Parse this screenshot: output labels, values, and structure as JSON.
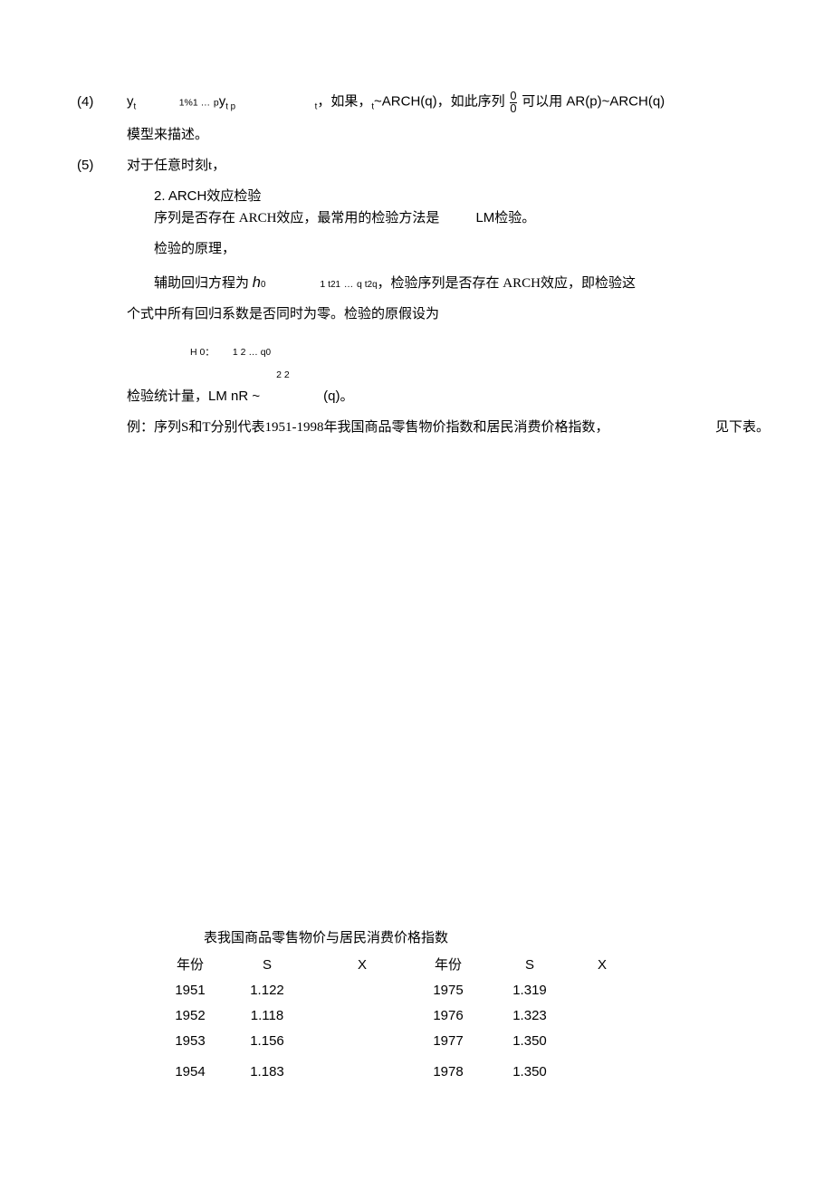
{
  "line4": {
    "num": "(4)",
    "eq_lhs_var": "y",
    "eq_lhs_sub": "t",
    "eq_rhs_1": "1%1 …",
    "eq_rhs_2_coef": "p",
    "eq_rhs_2_var": "y",
    "eq_rhs_2_sub": "t p",
    "eq_rhs_tail": "t",
    "text1": "，如果，",
    "cond_sub": "t",
    "text2": "~ARCH(q)，如此序列",
    "frac_top": "0",
    "frac_bot": "0",
    "text3": "可以用 AR(p)~ARCH(q)",
    "cont": "模型来描述。"
  },
  "line5": {
    "num": "(5)",
    "text": "对于任意时刻t，"
  },
  "sec2": {
    "title": "2.   ARCH效应检验",
    "p1a": "序列是否存在 ARCH效应，最常用的检验方法是",
    "p1b": "LM检验。",
    "p2": "检验的原理，",
    "aux_label": "辅助回归方程为",
    "aux_h": "h",
    "aux_sub0": "0",
    "aux_mid1": "1 t",
    "aux_exp1": "2",
    "aux_mid1b": "1",
    "aux_dots": "…",
    "aux_mid2a": "q t",
    "aux_exp2": "2",
    "aux_mid2b": "q",
    "aux_tail": "，检验序列是否存在 ARCH效应，即检验这",
    "p3": "个式中所有回归系数是否同时为零。检验的原假设为",
    "h0_label": "H 0：",
    "h0_body": "1       2     … q",
    "h0_end": "0",
    "stat_label": "检验统计量，",
    "stat_body": "LM nR ~",
    "stat_sup": "2 2",
    "stat_tail": "(q)。",
    "example_a": "例：序列S和T分别代表1951-1998年我国商品零售物价指数和居民消费价格指数，",
    "example_b": "见下表。"
  },
  "table": {
    "title": "表我国商品零售物价与居民消费价格指数",
    "headers": {
      "year": "年份",
      "s": "S",
      "x": "X"
    },
    "left": [
      {
        "year": "1951",
        "s": "1.122",
        "x": ""
      },
      {
        "year": "1952",
        "s": "1.118",
        "x": ""
      },
      {
        "year": "1953",
        "s": "1.156",
        "x": ""
      },
      {
        "year": "1954",
        "s": "1.183",
        "x": ""
      }
    ],
    "right": [
      {
        "year": "1975",
        "s": "1.319",
        "x": ""
      },
      {
        "year": "1976",
        "s": "1.323",
        "x": ""
      },
      {
        "year": "1977",
        "s": "1.350",
        "x": ""
      },
      {
        "year": "1978",
        "s": "1.350",
        "x": ""
      }
    ]
  }
}
